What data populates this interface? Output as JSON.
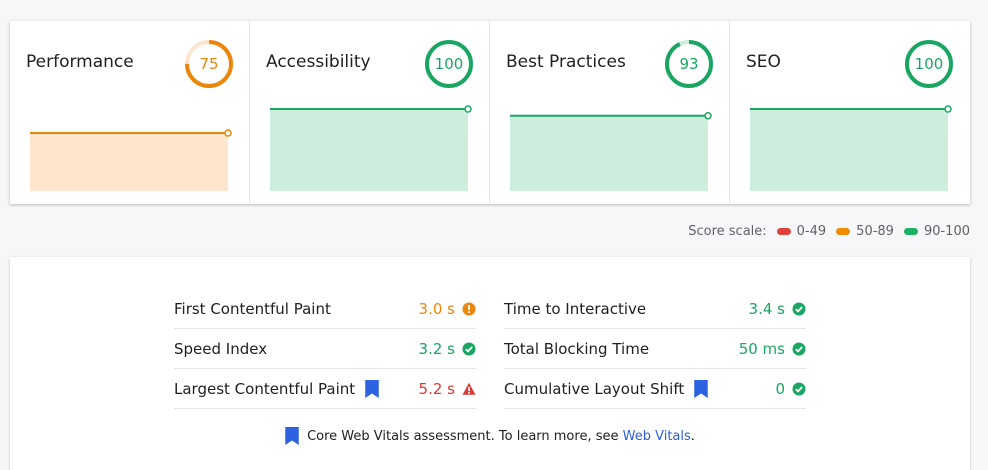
{
  "categories": [
    {
      "title": "Performance",
      "score": "75",
      "score_value": 75,
      "color": "#e8870c",
      "fill": "#fde6cd",
      "trend": [
        0.75,
        0.75
      ]
    },
    {
      "title": "Accessibility",
      "score": "100",
      "score_value": 100,
      "color": "#1aa661",
      "fill": "#cdeedc",
      "trend": [
        1.0,
        1.0
      ]
    },
    {
      "title": "Best Practices",
      "score": "93",
      "score_value": 93,
      "color": "#1aa661",
      "fill": "#cdeedc",
      "trend": [
        0.93,
        0.93
      ]
    },
    {
      "title": "SEO",
      "score": "100",
      "score_value": 100,
      "color": "#1aa661",
      "fill": "#cdeedc",
      "trend": [
        1.0,
        1.0
      ]
    }
  ],
  "scale": {
    "label": "Score scale:",
    "bands": [
      {
        "range": "0-49",
        "color": "#e0413b"
      },
      {
        "range": "50-89",
        "color": "#f08c00"
      },
      {
        "range": "90-100",
        "color": "#1bb263"
      }
    ]
  },
  "metrics": {
    "left": [
      {
        "label": "First Contentful Paint",
        "value": "3.0 s",
        "status": "average",
        "web_vital": false
      },
      {
        "label": "Speed Index",
        "value": "3.2 s",
        "status": "pass",
        "web_vital": false
      },
      {
        "label": "Largest Contentful Paint",
        "value": "5.2 s",
        "status": "fail",
        "web_vital": true
      }
    ],
    "right": [
      {
        "label": "Time to Interactive",
        "value": "3.4 s",
        "status": "pass",
        "web_vital": false
      },
      {
        "label": "Total Blocking Time",
        "value": "50 ms",
        "status": "pass",
        "web_vital": false
      },
      {
        "label": "Cumulative Layout Shift",
        "value": "0",
        "status": "pass",
        "web_vital": true
      }
    ]
  },
  "status_colors": {
    "pass": "#1aa661",
    "average": "#e8870c",
    "fail": "#d93a35"
  },
  "bookmark_color": "#2d62e0",
  "footer": {
    "text": "Core Web Vitals assessment. To learn more, see",
    "link": "Web Vitals",
    "suffix": "."
  }
}
